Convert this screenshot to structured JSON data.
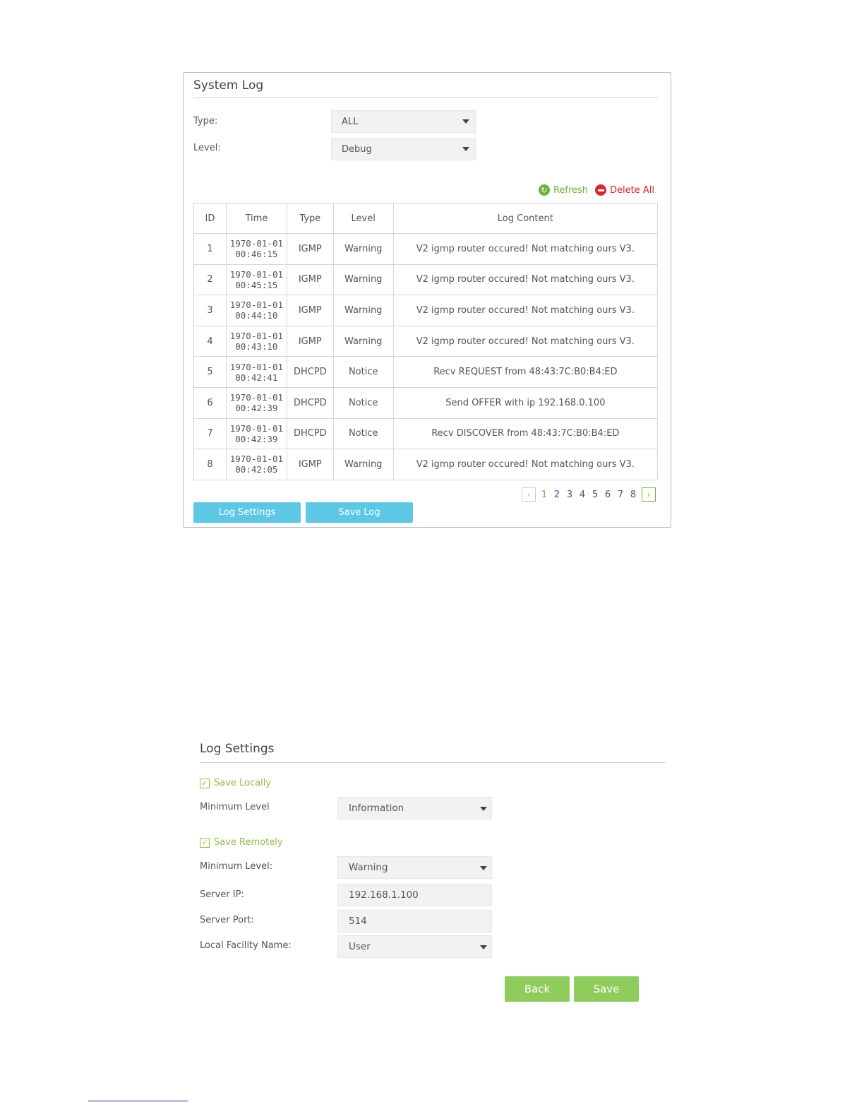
{
  "system_log": {
    "title": "System Log",
    "type_label": "Type:",
    "type_value": "ALL",
    "level_label": "Level:",
    "level_value": "Debug",
    "refresh_label": "Refresh",
    "delete_all_label": "Delete All",
    "columns": [
      "ID",
      "Time",
      "Type",
      "Level",
      "Log Content"
    ],
    "rows": [
      {
        "id": "1",
        "date": "1970-01-01",
        "clock": "00:46:15",
        "type": "IGMP",
        "level": "Warning",
        "content": "V2 igmp router occured! Not matching ours V3."
      },
      {
        "id": "2",
        "date": "1970-01-01",
        "clock": "00:45:15",
        "type": "IGMP",
        "level": "Warning",
        "content": "V2 igmp router occured! Not matching ours V3."
      },
      {
        "id": "3",
        "date": "1970-01-01",
        "clock": "00:44:10",
        "type": "IGMP",
        "level": "Warning",
        "content": "V2 igmp router occured! Not matching ours V3."
      },
      {
        "id": "4",
        "date": "1970-01-01",
        "clock": "00:43:10",
        "type": "IGMP",
        "level": "Warning",
        "content": "V2 igmp router occured! Not matching ours V3."
      },
      {
        "id": "5",
        "date": "1970-01-01",
        "clock": "00:42:41",
        "type": "DHCPD",
        "level": "Notice",
        "content": "Recv REQUEST from 48:43:7C:B0:B4:ED"
      },
      {
        "id": "6",
        "date": "1970-01-01",
        "clock": "00:42:39",
        "type": "DHCPD",
        "level": "Notice",
        "content": "Send OFFER with ip 192.168.0.100"
      },
      {
        "id": "7",
        "date": "1970-01-01",
        "clock": "00:42:39",
        "type": "DHCPD",
        "level": "Notice",
        "content": "Recv DISCOVER from 48:43:7C:B0:B4:ED"
      },
      {
        "id": "8",
        "date": "1970-01-01",
        "clock": "00:42:05",
        "type": "IGMP",
        "level": "Warning",
        "content": "V2 igmp router occured! Not matching ours V3."
      }
    ],
    "pages": [
      "1",
      "2",
      "3",
      "4",
      "5",
      "6",
      "7",
      "8"
    ],
    "current_page": "1",
    "log_settings_button": "Log Settings",
    "save_log_button": "Save Log"
  },
  "log_settings": {
    "title": "Log Settings",
    "save_locally_label": "Save Locally",
    "save_locally_checked": true,
    "local_min_level_label": "Minimum Level",
    "local_min_level_value": "Information",
    "save_remotely_label": "Save Remotely",
    "save_remotely_checked": true,
    "remote_min_level_label": "Minimum Level:",
    "remote_min_level_value": "Warning",
    "server_ip_label": "Server IP:",
    "server_ip_value": "192.168.1.100",
    "server_port_label": "Server Port:",
    "server_port_value": "514",
    "facility_label": "Local Facility Name:",
    "facility_value": "User",
    "back_button": "Back",
    "save_button": "Save"
  },
  "colors": {
    "accent_green": "#8ecc5c",
    "refresh_green": "#6cb33e",
    "delete_red": "#d9262f",
    "button_blue": "#5cc8e6"
  },
  "icons": {
    "refresh": "refresh-icon",
    "delete": "delete-icon",
    "dropdown": "chevron-down-icon",
    "checkbox": "checkbox-checked-icon",
    "prev": "chevron-left-icon",
    "next": "chevron-right-icon"
  }
}
